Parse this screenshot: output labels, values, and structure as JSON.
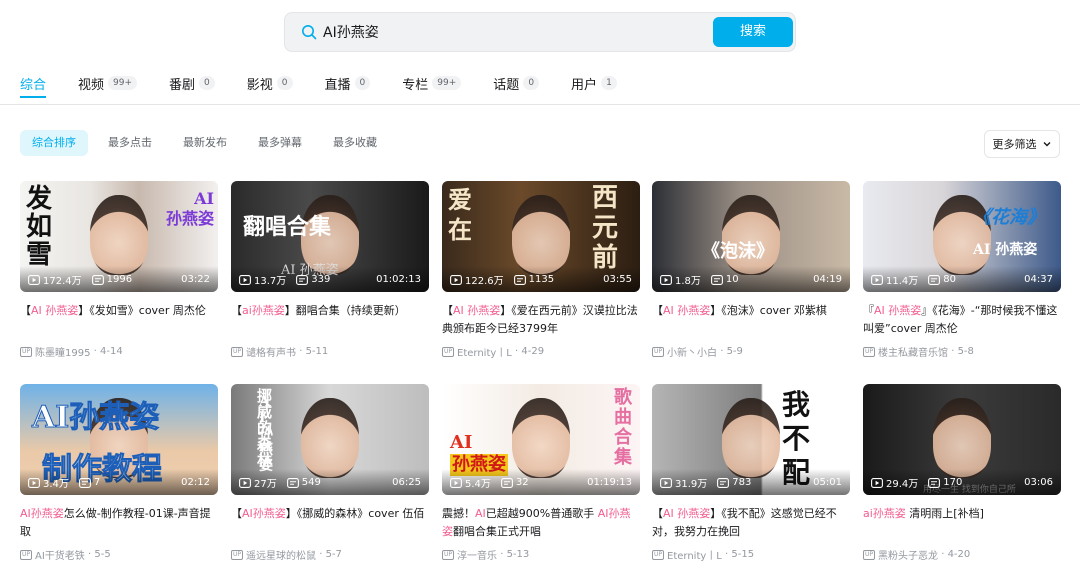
{
  "search": {
    "value": "AI孙燕姿",
    "button": "搜索"
  },
  "tabs": [
    {
      "label": "综合",
      "count": ""
    },
    {
      "label": "视频",
      "count": "99+"
    },
    {
      "label": "番剧",
      "count": "0"
    },
    {
      "label": "影视",
      "count": "0"
    },
    {
      "label": "直播",
      "count": "0"
    },
    {
      "label": "专栏",
      "count": "99+"
    },
    {
      "label": "话题",
      "count": "0"
    },
    {
      "label": "用户",
      "count": "1"
    }
  ],
  "sorts": [
    "综合排序",
    "最多点击",
    "最新发布",
    "最多弹幕",
    "最多收藏"
  ],
  "more_filter": "更多筛选",
  "colors": {
    "accent": "#00aeec",
    "highlight": "#f25d8e"
  },
  "videos": [
    {
      "plays": "172.4万",
      "danmaku": "1996",
      "duration": "03:22",
      "title_parts": [
        "【",
        "AI 孙燕姿",
        "】《发如雪》cover 周杰伦"
      ],
      "author": "陈墨瞳1995",
      "date": "4-14",
      "overlay": [
        "发",
        "如",
        "雪"
      ],
      "overlay2": [
        "AI",
        "孙燕姿"
      ]
    },
    {
      "plays": "13.7万",
      "danmaku": "339",
      "duration": "01:02:13",
      "title_parts": [
        "【",
        "ai孙燕姿",
        "】翻唱合集（持续更新）"
      ],
      "author": "谴格有声书",
      "date": "5-11",
      "overlay": [
        "翻唱合集"
      ],
      "overlay2": [
        "AI 孙燕姿"
      ]
    },
    {
      "plays": "122.6万",
      "danmaku": "1135",
      "duration": "03:55",
      "title_parts": [
        "【",
        "AI 孙燕姿",
        "】《爱在西元前》汉谟拉比法典颁布距今已经3799年"
      ],
      "author": "Eternity丨L",
      "date": "4-29",
      "overlay": [
        "爱",
        "在"
      ],
      "overlay2": [
        "西",
        "元",
        "前"
      ]
    },
    {
      "plays": "1.8万",
      "danmaku": "10",
      "duration": "04:19",
      "title_parts": [
        "【",
        "AI 孙燕姿",
        "】《泡沫》cover 邓紫棋"
      ],
      "author": "小新丶小白",
      "date": "5-9",
      "overlay": [
        "《泡沫》"
      ],
      "overlay2": []
    },
    {
      "plays": "11.4万",
      "danmaku": "80",
      "duration": "04:37",
      "title_parts": [
        "『",
        "AI 孙燕姿",
        "』《花海》-“那时候我不懂这叫爱”cover 周杰伦"
      ],
      "author": "楼主私藏音乐馆",
      "date": "5-8",
      "overlay": [
        "《花海》"
      ],
      "overlay2": [
        "AI 孙燕姿"
      ]
    },
    {
      "plays": "3.4万",
      "danmaku": "7",
      "duration": "02:12",
      "title_parts": [
        "",
        "AI孙燕姿",
        "怎么做-制作教程-01课-声音提取"
      ],
      "author": "AI干货老铁",
      "date": "5-5",
      "overlay": [
        "AI孙燕姿"
      ],
      "overlay2": [
        "制作教程"
      ]
    },
    {
      "plays": "27万",
      "danmaku": "549",
      "duration": "06:25",
      "title_parts": [
        "【",
        "AI孙燕姿",
        "】《挪威的森林》cover 伍佰"
      ],
      "author": "遥远星球的松鼠",
      "date": "5-7",
      "overlay": [
        "挪",
        "威",
        "的",
        "森",
        "林"
      ],
      "overlay2": [
        "A",
        "I",
        "孙",
        "燕",
        "姿"
      ]
    },
    {
      "plays": "5.4万",
      "danmaku": "32",
      "duration": "01:19:13",
      "title_parts": [
        "震撼！",
        "AI",
        "已超越900%普通歌手 ",
        "AI孙燕姿",
        "翻唱合集正式开唱"
      ],
      "author": "淳一音乐",
      "date": "5-13",
      "overlay": [
        "歌",
        "曲",
        "合",
        "集"
      ],
      "overlay2": [
        "AI",
        "孙燕姿"
      ]
    },
    {
      "plays": "31.9万",
      "danmaku": "783",
      "duration": "05:01",
      "title_parts": [
        "【",
        "AI 孙燕姿",
        "】《我不配》这感觉已经不对，我努力在挽回"
      ],
      "author": "Eternity丨L",
      "date": "5-15",
      "overlay": [
        "我",
        "不",
        "配"
      ],
      "overlay2": []
    },
    {
      "plays": "29.4万",
      "danmaku": "170",
      "duration": "03:06",
      "title_parts": [
        "",
        "ai孙燕姿",
        " 清明雨上[补档]"
      ],
      "author": "黑粉头子恶龙",
      "date": "4-20",
      "overlay": [
        "用尽一生 找到你自己所"
      ],
      "overlay2": []
    }
  ]
}
